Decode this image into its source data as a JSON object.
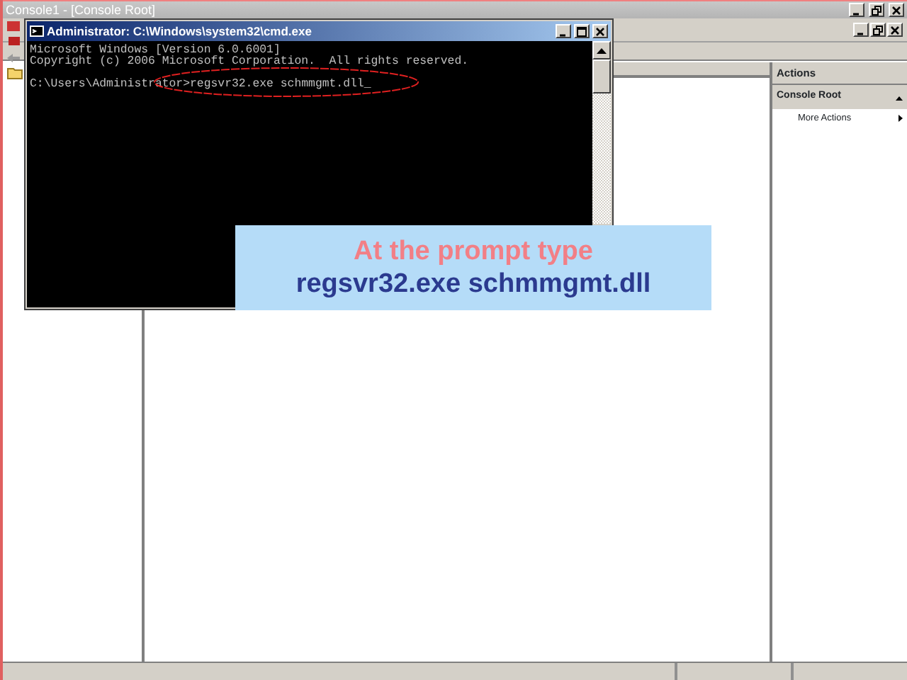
{
  "window": {
    "title": "Console1 - [Console Root]"
  },
  "actions_pane": {
    "header": "Actions",
    "section": "Console Root",
    "items": [
      "More Actions"
    ]
  },
  "cmd_window": {
    "title": "Administrator: C:\\Windows\\system32\\cmd.exe",
    "lines": [
      {
        "kind": "output",
        "text": "Microsoft Windows [Version 6.0.6001]"
      },
      {
        "kind": "output",
        "text": "Copyright (c) 2006 Microsoft Corporation.  All rights reserved."
      },
      {
        "kind": "command",
        "text": "C:\\Users\\Administrator>regsvr32.exe schmmgmt.dll_"
      }
    ]
  },
  "callout": {
    "title": "At the prompt type",
    "command": "regsvr32.exe schmmgmt.dll"
  }
}
